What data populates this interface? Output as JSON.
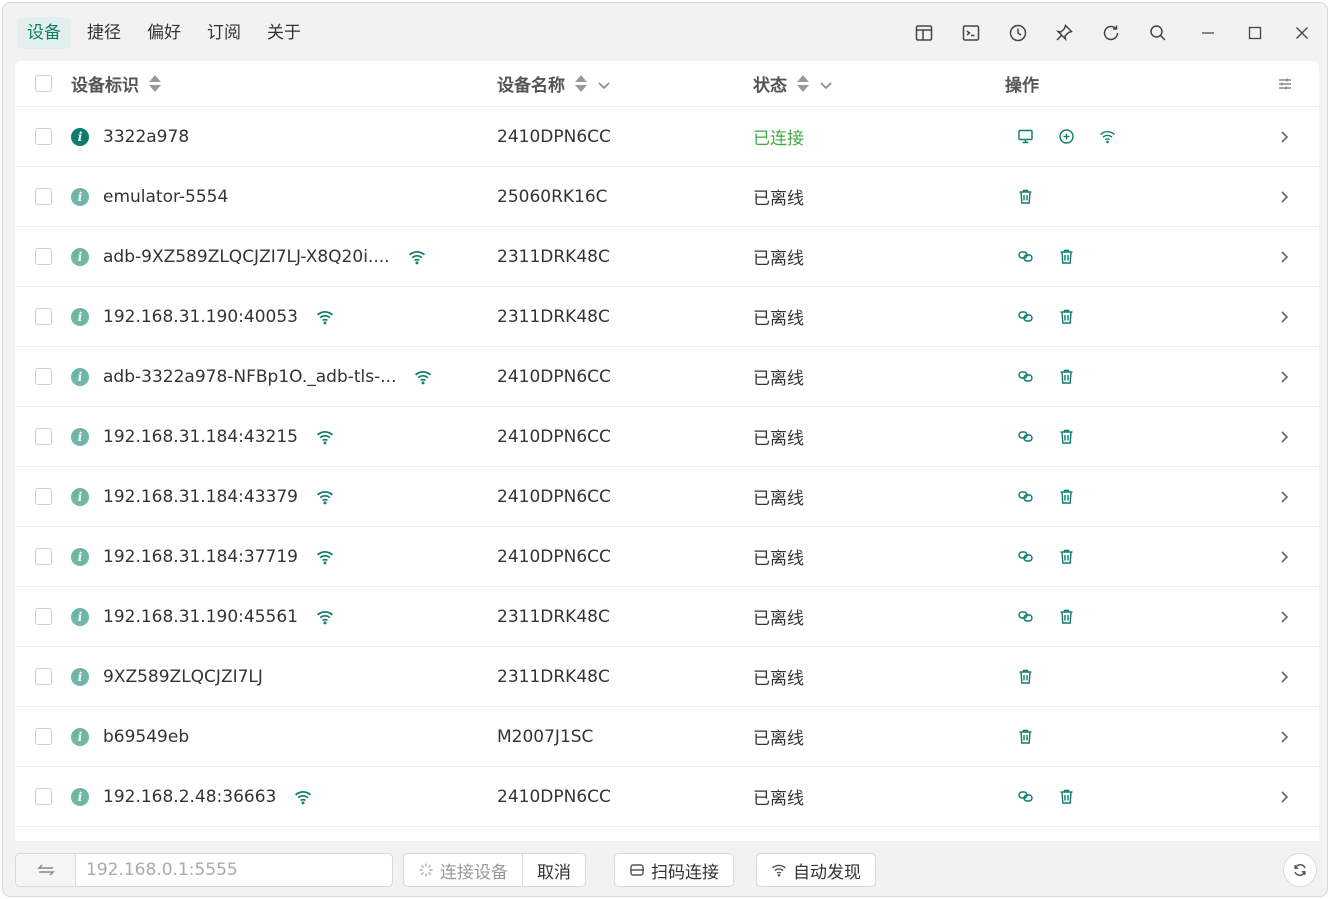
{
  "menu": {
    "items": [
      {
        "label": "设备",
        "active": true
      },
      {
        "label": "捷径",
        "active": false
      },
      {
        "label": "偏好",
        "active": false
      },
      {
        "label": "订阅",
        "active": false
      },
      {
        "label": "关于",
        "active": false
      }
    ]
  },
  "toolbar": {
    "icons": [
      "layout-icon",
      "terminal-icon",
      "history-icon",
      "pin-icon",
      "reload-icon",
      "search-icon"
    ]
  },
  "window_controls": [
    "minimize-icon",
    "maximize-icon",
    "close-icon"
  ],
  "table": {
    "headers": {
      "id": "设备标识",
      "name": "设备名称",
      "state": "状态",
      "actions": "操作"
    },
    "rows": [
      {
        "id": "3322a978",
        "wifi": false,
        "name": "2410DPN6CC",
        "state": "已连接",
        "online": true,
        "actions": [
          "screen-mirror-icon",
          "add-circle-icon",
          "wifi-icon"
        ]
      },
      {
        "id": "emulator-5554",
        "wifi": false,
        "name": "25060RK16C",
        "state": "已离线",
        "online": false,
        "actions": [
          "delete-icon"
        ]
      },
      {
        "id": "adb-9XZ589ZLQCJZI7LJ-X8Q20i....",
        "wifi": true,
        "name": "2311DRK48C",
        "state": "已离线",
        "online": false,
        "actions": [
          "link-icon",
          "delete-icon"
        ]
      },
      {
        "id": "192.168.31.190:40053",
        "wifi": true,
        "name": "2311DRK48C",
        "state": "已离线",
        "online": false,
        "actions": [
          "link-icon",
          "delete-icon"
        ]
      },
      {
        "id": "adb-3322a978-NFBp1O._adb-tls-...",
        "wifi": true,
        "name": "2410DPN6CC",
        "state": "已离线",
        "online": false,
        "actions": [
          "link-icon",
          "delete-icon"
        ]
      },
      {
        "id": "192.168.31.184:43215",
        "wifi": true,
        "name": "2410DPN6CC",
        "state": "已离线",
        "online": false,
        "actions": [
          "link-icon",
          "delete-icon"
        ]
      },
      {
        "id": "192.168.31.184:43379",
        "wifi": true,
        "name": "2410DPN6CC",
        "state": "已离线",
        "online": false,
        "actions": [
          "link-icon",
          "delete-icon"
        ]
      },
      {
        "id": "192.168.31.184:37719",
        "wifi": true,
        "name": "2410DPN6CC",
        "state": "已离线",
        "online": false,
        "actions": [
          "link-icon",
          "delete-icon"
        ]
      },
      {
        "id": "192.168.31.190:45561",
        "wifi": true,
        "name": "2311DRK48C",
        "state": "已离线",
        "online": false,
        "actions": [
          "link-icon",
          "delete-icon"
        ]
      },
      {
        "id": "9XZ589ZLQCJZI7LJ",
        "wifi": false,
        "name": "2311DRK48C",
        "state": "已离线",
        "online": false,
        "actions": [
          "delete-icon"
        ]
      },
      {
        "id": "b69549eb",
        "wifi": false,
        "name": "M2007J1SC",
        "state": "已离线",
        "online": false,
        "actions": [
          "delete-icon"
        ]
      },
      {
        "id": "192.168.2.48:36663",
        "wifi": true,
        "name": "2410DPN6CC",
        "state": "已离线",
        "online": false,
        "actions": [
          "link-icon",
          "delete-icon"
        ]
      }
    ]
  },
  "bottom": {
    "address_placeholder": "192.168.0.1:5555",
    "connect_label": "连接设备",
    "cancel_label": "取消",
    "scan_label": "扫码连接",
    "discover_label": "自动发现"
  },
  "colors": {
    "accent": "#0f7b6c",
    "online": "#3fae3f",
    "offline_info": "#6fb6a5"
  }
}
